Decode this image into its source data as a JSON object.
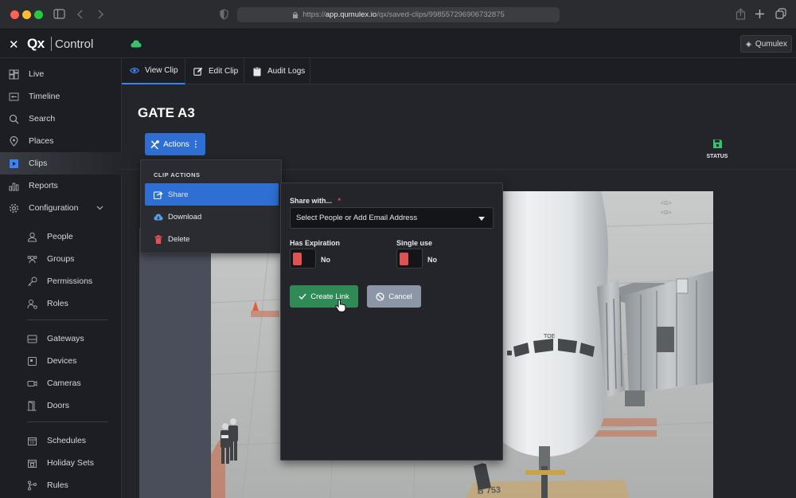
{
  "browser": {
    "url_prefix": "https://",
    "url_host": "app.qumulex.io",
    "url_path": "/qx/saved-clips/998557296906732875"
  },
  "topbar": {
    "logo_mark": "Qx",
    "logo_text": "Control",
    "account_label": "Qumulex"
  },
  "sidebar": {
    "items": [
      {
        "label": "Live",
        "icon": "grid-icon"
      },
      {
        "label": "Timeline",
        "icon": "timeline-icon"
      },
      {
        "label": "Search",
        "icon": "search-icon"
      },
      {
        "label": "Places",
        "icon": "map-pin-icon"
      },
      {
        "label": "Clips",
        "icon": "clip-icon",
        "active": true
      },
      {
        "label": "Reports",
        "icon": "bar-chart-icon"
      },
      {
        "label": "Configuration",
        "icon": "gear-icon"
      }
    ],
    "config_items": [
      {
        "label": "People",
        "icon": "user-icon"
      },
      {
        "label": "Groups",
        "icon": "users-icon"
      },
      {
        "label": "Permissions",
        "icon": "key-icon"
      },
      {
        "label": "Roles",
        "icon": "roles-icon"
      },
      {
        "label": "Gateways",
        "icon": "gateway-icon"
      },
      {
        "label": "Devices",
        "icon": "device-icon"
      },
      {
        "label": "Cameras",
        "icon": "camera-icon"
      },
      {
        "label": "Doors",
        "icon": "door-icon"
      },
      {
        "label": "Schedules",
        "icon": "calendar-icon"
      },
      {
        "label": "Holiday Sets",
        "icon": "holiday-calendar-icon"
      },
      {
        "label": "Rules",
        "icon": "rules-icon"
      }
    ]
  },
  "tabs": [
    {
      "label": "View Clip",
      "icon": "eye-icon",
      "active": true
    },
    {
      "label": "Edit Clip",
      "icon": "edit-icon"
    },
    {
      "label": "Audit Logs",
      "icon": "clipboard-icon"
    }
  ],
  "main": {
    "title": "GATE A3",
    "status_label": "STATUS",
    "actions_label": "Actions"
  },
  "clip_actions": {
    "heading": "CLIP ACTIONS",
    "items": [
      {
        "label": "Share",
        "icon": "share-icon",
        "active": true
      },
      {
        "label": "Download",
        "icon": "cloud-download-icon"
      },
      {
        "label": "Delete",
        "icon": "trash-icon"
      }
    ]
  },
  "share_panel": {
    "share_with_label": "Share with...",
    "required_marker": "*",
    "select_placeholder": "Select People or Add Email Address",
    "has_expiration_label": "Has Expiration",
    "has_expiration_value": "No",
    "single_use_label": "Single use",
    "single_use_value": "No",
    "create_link_label": "Create Link",
    "cancel_label": "Cancel"
  },
  "photo": {
    "plane_label": "TOE",
    "ground_marking": "B 753"
  },
  "colors": {
    "accent": "#3b82f6",
    "primary_button": "#2f6fd3",
    "success": "#2f8a55",
    "status_icon": "#39c26b",
    "toggle_off": "#e05252",
    "cancel_button": "#8d96a6"
  }
}
